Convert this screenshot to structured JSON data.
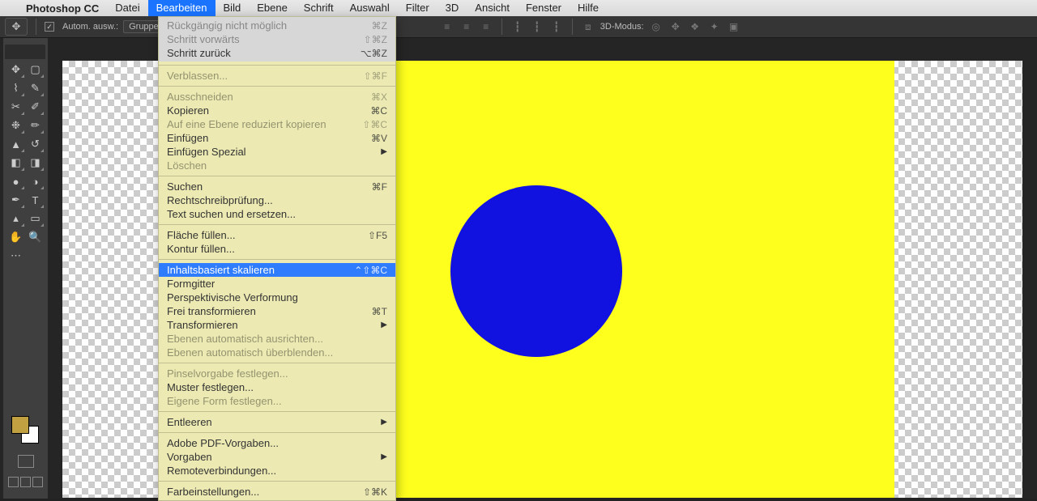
{
  "menubar": {
    "app_name": "Photoshop CC",
    "items": [
      "Datei",
      "Bearbeiten",
      "Bild",
      "Ebene",
      "Schrift",
      "Auswahl",
      "Filter",
      "3D",
      "Ansicht",
      "Fenster",
      "Hilfe"
    ],
    "active_index": 1
  },
  "optionsbar": {
    "auto_select_label": "Autom. ausw.:",
    "group_label": "Gruppe",
    "mode_label": "3D-Modus:"
  },
  "menu": {
    "g1": [
      {
        "label": "Rückgängig nicht möglich",
        "short": "⌘Z",
        "disabled": true
      },
      {
        "label": "Schritt vorwärts",
        "short": "⇧⌘Z",
        "disabled": true
      },
      {
        "label": "Schritt zurück",
        "short": "⌥⌘Z"
      }
    ],
    "g2": [
      {
        "label": "Verblassen...",
        "short": "⇧⌘F",
        "disabled": true
      }
    ],
    "g3": [
      {
        "label": "Ausschneiden",
        "short": "⌘X",
        "disabled": true
      },
      {
        "label": "Kopieren",
        "short": "⌘C"
      },
      {
        "label": "Auf eine Ebene reduziert kopieren",
        "short": "⇧⌘C",
        "disabled": true
      },
      {
        "label": "Einfügen",
        "short": "⌘V"
      },
      {
        "label": "Einfügen Spezial",
        "arrow": true
      },
      {
        "label": "Löschen",
        "disabled": true
      }
    ],
    "g4": [
      {
        "label": "Suchen",
        "short": "⌘F"
      },
      {
        "label": "Rechtschreibprüfung..."
      },
      {
        "label": "Text suchen und ersetzen..."
      }
    ],
    "g5": [
      {
        "label": "Fläche füllen...",
        "short": "⇧F5"
      },
      {
        "label": "Kontur füllen..."
      }
    ],
    "g6": [
      {
        "label": "Inhaltsbasiert skalieren",
        "short": "⌃⇧⌘C",
        "highlight": true
      },
      {
        "label": "Formgitter"
      },
      {
        "label": "Perspektivische Verformung"
      },
      {
        "label": "Frei transformieren",
        "short": "⌘T"
      },
      {
        "label": "Transformieren",
        "arrow": true
      },
      {
        "label": "Ebenen automatisch ausrichten...",
        "disabled": true
      },
      {
        "label": "Ebenen automatisch überblenden...",
        "disabled": true
      }
    ],
    "g7": [
      {
        "label": "Pinselvorgabe festlegen...",
        "disabled": true
      },
      {
        "label": "Muster festlegen..."
      },
      {
        "label": "Eigene Form festlegen...",
        "disabled": true
      }
    ],
    "g8": [
      {
        "label": "Entleeren",
        "arrow": true
      }
    ],
    "g9": [
      {
        "label": "Adobe PDF-Vorgaben..."
      },
      {
        "label": "Vorgaben",
        "arrow": true
      },
      {
        "label": "Remoteverbindungen..."
      }
    ],
    "g10": [
      {
        "label": "Farbeinstellungen...",
        "short": "⇧⌘K"
      }
    ]
  }
}
